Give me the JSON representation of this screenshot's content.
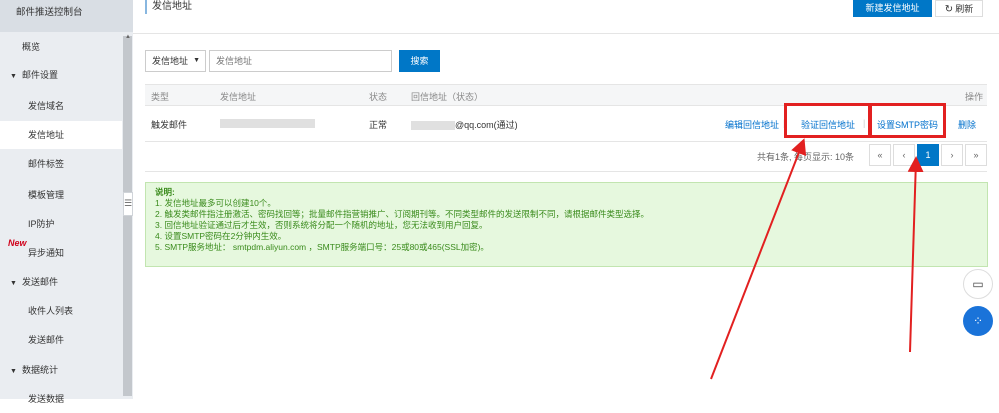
{
  "sidebar": {
    "title": "邮件推送控制台",
    "overview": "概览",
    "mail_settings": "邮件设置",
    "items": [
      "发信域名",
      "发信地址",
      "邮件标签",
      "模板管理",
      "IP防护",
      "异步通知"
    ],
    "new_badge": "New",
    "send_mail": "发送邮件",
    "send_items": [
      "收件人列表",
      "发送邮件"
    ],
    "data_stats": "数据统计",
    "cut_item": "发送数据"
  },
  "header": {
    "title": "发信地址",
    "new_button": "新建发信地址",
    "refresh_button": "刷新"
  },
  "filter": {
    "select_value": "发信地址",
    "input_placeholder": "发信地址",
    "search_button": "搜索"
  },
  "table": {
    "headers": [
      "类型",
      "发信地址",
      "状态",
      "回信地址（状态）",
      "操作"
    ],
    "rows": [
      {
        "type": "触发邮件",
        "status": "正常",
        "reply_suffix": "@qq.com(通过)",
        "actions": [
          "编辑回信地址",
          "验证回信地址",
          "设置SMTP密码",
          "删除"
        ]
      }
    ]
  },
  "pagination": {
    "info": "共有1条, 每页显示: 10条",
    "buttons": [
      "«",
      "‹",
      "1",
      "›",
      "»"
    ],
    "current": "1"
  },
  "notice": {
    "title": "说明:",
    "lines": [
      "1. 发信地址最多可以创建10个。",
      "2. 触发类邮件指注册激活、密码找回等；批量邮件指营销推广、订阅期刊等。不同类型邮件的发送限制不同，请根据邮件类型选择。",
      "3. 回信地址验证通过后才生效，否则系统将分配一个随机的地址，您无法收到用户回复。",
      "4. 设置SMTP密码在2分钟内生效。",
      "5. SMTP服务地址： smtpdm.aliyun.com ，SMTP服务端口号：25或80或465(SSL加密)。"
    ]
  },
  "colors": {
    "primary": "#0077c7",
    "annotation_red": "#e22020",
    "notice_bg": "#e6f8de",
    "notice_text": "#3a8b1c"
  }
}
